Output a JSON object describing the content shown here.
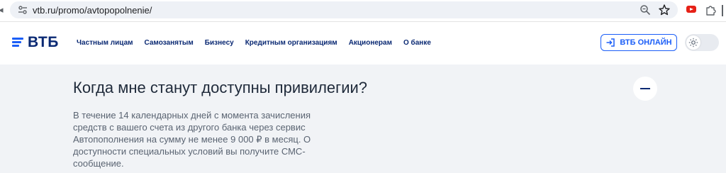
{
  "browser": {
    "url": "vtb.ru/promo/avtopopolnenie/"
  },
  "header": {
    "logo_text": "ВТБ",
    "nav": [
      {
        "label": "Частным лицам"
      },
      {
        "label": "Самозанятым"
      },
      {
        "label": "Бизнесу"
      },
      {
        "label": "Кредитным организациям"
      },
      {
        "label": "Акционерам"
      },
      {
        "label": "О банке"
      }
    ],
    "online_button_label": "ВТБ ОНЛАЙН"
  },
  "faq": {
    "question": "Когда мне станут доступны привилегии?",
    "answer": "В течение 14 календарных дней с момента зачисления средств с вашего счета из другого банка через сервис Автопополнения на сумму не менее 9 000 ₽ в месяц. О доступности специальных условий вы получите СМС-сообщение."
  },
  "colors": {
    "brand_blue": "#1b5ef7",
    "brand_navy": "#0a2973",
    "page_bg": "#f1f3f6"
  }
}
